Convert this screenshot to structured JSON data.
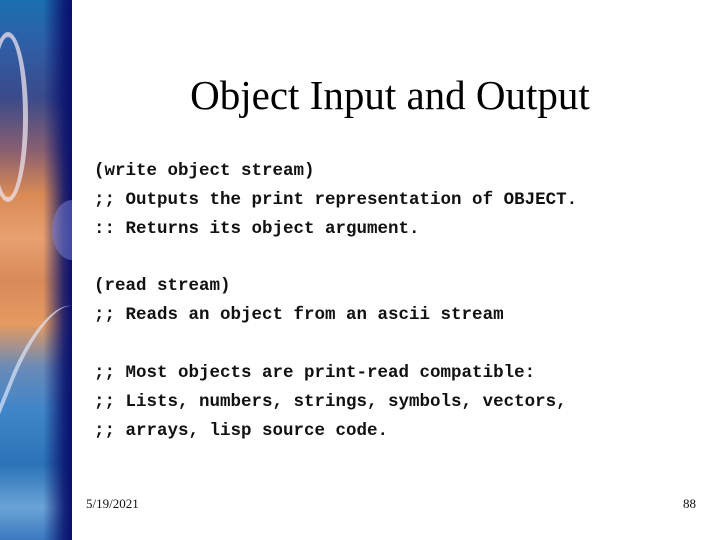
{
  "slide": {
    "title": "Object Input and Output",
    "blocks": [
      {
        "lines": [
          "(write object stream)",
          ";; Outputs the print representation of OBJECT.",
          ":: Returns its object argument."
        ]
      },
      {
        "lines": [
          "(read stream)",
          ";; Reads an object from an ascii stream"
        ]
      },
      {
        "lines": [
          ";; Most objects are print-read compatible:",
          ";; Lists, numbers, strings, symbols, vectors,",
          ";; arrays, lisp source code."
        ]
      }
    ],
    "footer": {
      "date": "5/19/2021",
      "page_number": "88"
    }
  }
}
